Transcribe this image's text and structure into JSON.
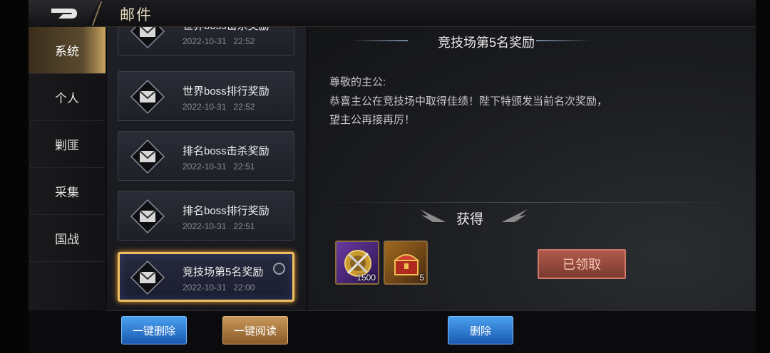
{
  "header": {
    "title": "邮件",
    "back_icon": "back-arrow-icon"
  },
  "sidebar": {
    "items": [
      {
        "label": "系统",
        "active": true
      },
      {
        "label": "个人",
        "active": false
      },
      {
        "label": "剿匪",
        "active": false
      },
      {
        "label": "采集",
        "active": false
      },
      {
        "label": "国战",
        "active": false
      }
    ]
  },
  "mails": [
    {
      "title": "世界boss击杀奖励",
      "date": "2022-10-31",
      "time": "22:52"
    },
    {
      "title": "世界boss排行奖励",
      "date": "2022-10-31",
      "time": "22:52"
    },
    {
      "title": "排名boss击杀奖励",
      "date": "2022-10-31",
      "time": "22:51"
    },
    {
      "title": "排名boss排行奖励",
      "date": "2022-10-31",
      "time": "22:51"
    },
    {
      "title": "竞技场第5名奖励",
      "date": "2022-10-31",
      "time": "22:00",
      "selected": true
    }
  ],
  "detail": {
    "title": "竞技场第5名奖励",
    "greeting": "尊敬的主公:",
    "body_line1": "恭喜主公在竞技场中取得佳绩！陛下特颁发当前名次奖励，",
    "body_line2": "望主公再接再厉！",
    "reward_label": "获得",
    "rewards": [
      {
        "icon": "gold-medal-icon",
        "count": "1500",
        "rarity": "purple"
      },
      {
        "icon": "treasure-chest-icon",
        "count": "5",
        "rarity": "gold"
      }
    ],
    "claimed_label": "已领取"
  },
  "footer": {
    "delete_all": "一键删除",
    "read_all": "一键阅读",
    "delete": "删除"
  }
}
